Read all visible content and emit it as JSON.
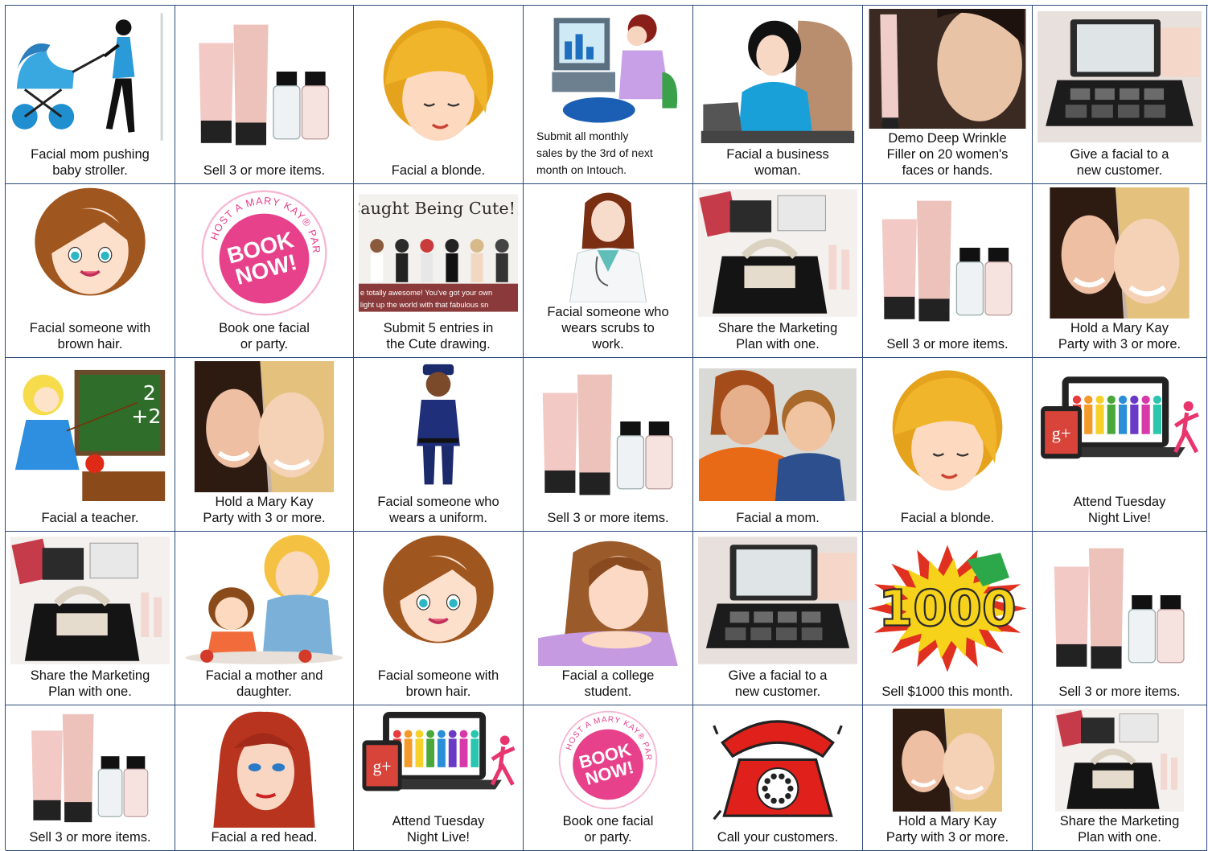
{
  "bingo": {
    "rows": [
      [
        {
          "text": "Facial mom pushing\nbaby stroller.",
          "pic": "mom-stroller"
        },
        {
          "text": "Sell 3 or more items.",
          "pic": "products"
        },
        {
          "text": "Facial a blonde.",
          "pic": "blonde"
        },
        {
          "text": "Submit all monthly\nsales by the 3rd of next\nmonth on Intouch.",
          "pic": "computer-woman",
          "small": true
        },
        {
          "text": "Facial a business\nwoman.",
          "pic": "business-woman"
        },
        {
          "text": "Demo Deep Wrinkle\nFiller on 20 women's\nfaces or hands.",
          "pic": "wrinkle-filler"
        },
        {
          "text": "Give a facial to a\nnew customer.",
          "pic": "compact"
        }
      ],
      [
        {
          "text": "Facial someone with\nbrown hair.",
          "pic": "brown-hair"
        },
        {
          "text": "Book one facial\nor party.",
          "pic": "book-now",
          "badge_top": "HOST A MARY KAY® PARTY",
          "badge_main": "BOOK\nNOW!"
        },
        {
          "text": "Submit 5 entries in\nthe Cute drawing.",
          "pic": "cute-banner",
          "banner_title": "Caught Being Cute!!!",
          "banner_sub1": "e totally awesome! You've got your own",
          "banner_sub2": "light up the world with that fabulous sn"
        },
        {
          "text": "Facial someone who\nwears scrubs to\nwork.",
          "pic": "doctor"
        },
        {
          "text": "Share the Marketing\nPlan with one.",
          "pic": "starter-kit"
        },
        {
          "text": "Sell 3 or more items.",
          "pic": "products"
        },
        {
          "text": "Hold a Mary Kay\nParty with 3 or more.",
          "pic": "two-women"
        }
      ],
      [
        {
          "text": "Facial a teacher.",
          "pic": "teacher",
          "board_top": "2",
          "board_bottom": "+2"
        },
        {
          "text": "Hold a Mary Kay\nParty with 3 or more.",
          "pic": "two-women"
        },
        {
          "text": "Facial someone who\nwears a uniform.",
          "pic": "officer"
        },
        {
          "text": "Sell 3 or more items.",
          "pic": "products"
        },
        {
          "text": "Facial a mom.",
          "pic": "mom-child"
        },
        {
          "text": "Facial a blonde.",
          "pic": "blonde"
        },
        {
          "text": "Attend Tuesday\nNight Live!",
          "pic": "laptop-gplus",
          "gplus": "g+"
        }
      ],
      [
        {
          "text": "Share the Marketing\nPlan with one.",
          "pic": "starter-kit"
        },
        {
          "text": "Facial a mother and\ndaughter.",
          "pic": "mother-daughter"
        },
        {
          "text": "Facial someone with\nbrown hair.",
          "pic": "brown-hair"
        },
        {
          "text": "Facial a college\nstudent.",
          "pic": "college-student"
        },
        {
          "text": "Give a facial to a\nnew customer.",
          "pic": "compact"
        },
        {
          "text": "Sell $1000 this month.",
          "pic": "burst-1000",
          "burst_text": "1000"
        },
        {
          "text": "Sell 3 or more items.",
          "pic": "products"
        }
      ],
      [
        {
          "text": "Sell 3 or more items.",
          "pic": "products"
        },
        {
          "text": "Facial a red head.",
          "pic": "red-head"
        },
        {
          "text": "Attend Tuesday\nNight Live!",
          "pic": "laptop-gplus",
          "gplus": "g+"
        },
        {
          "text": "Book one facial\nor party.",
          "pic": "book-now",
          "badge_top": "HOST A MARY KAY® PARTY",
          "badge_main": "BOOK\nNOW!"
        },
        {
          "text": "Call your customers.",
          "pic": "telephone"
        },
        {
          "text": "Hold a Mary Kay\nParty with 3 or more.",
          "pic": "two-women"
        },
        {
          "text": "Share the Marketing\nPlan with one.",
          "pic": "starter-kit"
        }
      ]
    ]
  },
  "colors": {
    "grid_line": "#2d4a7a",
    "badge_pink": "#e8418c",
    "mk_pink": "#f2c9c4",
    "phone_red": "#e0201a",
    "burst_yellow": "#f7d21a",
    "burst_red": "#e03020"
  }
}
